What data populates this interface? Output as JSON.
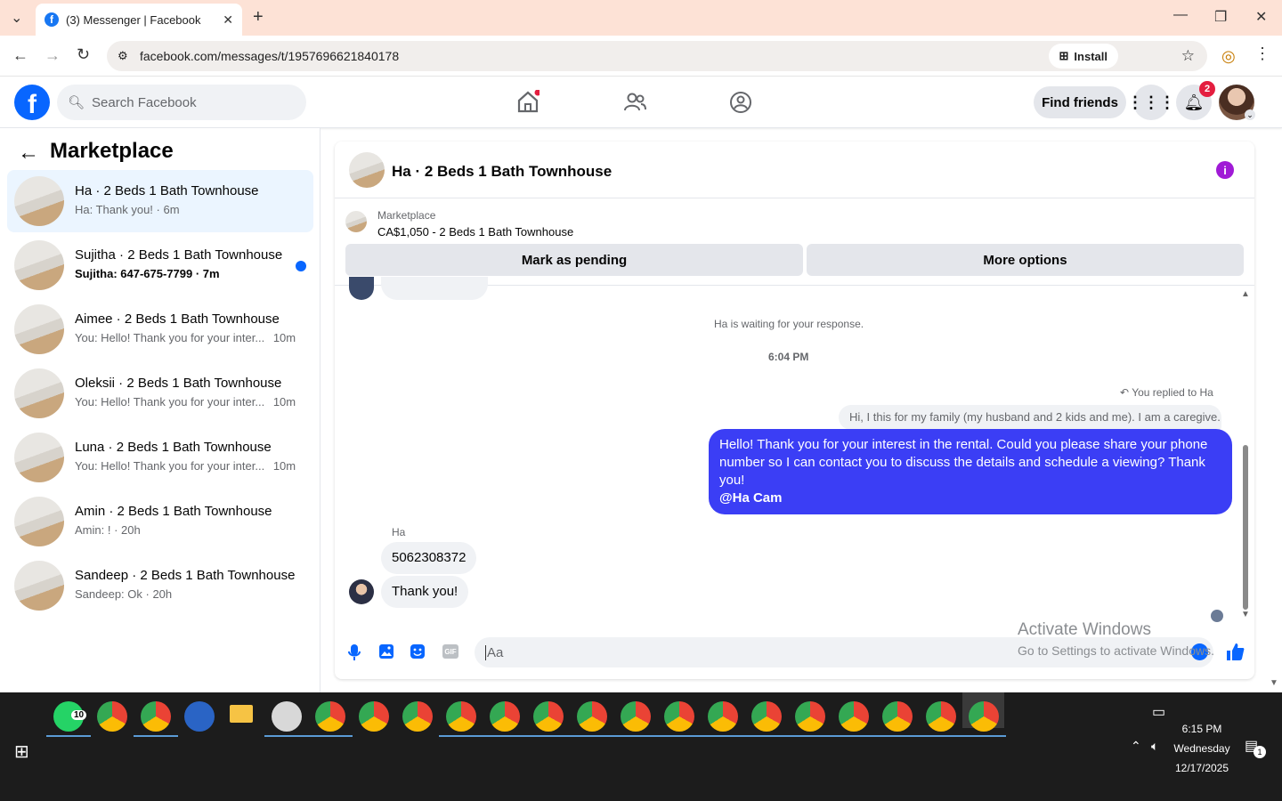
{
  "browser": {
    "tab_title": "(3) Messenger | Facebook",
    "tab_favicon": "f",
    "new_tab": "+",
    "url": "facebook.com/messages/t/1957696621840178",
    "install_label": "Install"
  },
  "fb": {
    "logo": "f",
    "search_placeholder": "Search Facebook",
    "find_friends": "Find friends",
    "notif_count": "2"
  },
  "sidebar": {
    "title": "Marketplace",
    "conversations": [
      {
        "title": "Ha · 2 Beds 1 Bath Townhouse",
        "snippet": "Ha: Thank you! · 6m",
        "selected": true
      },
      {
        "title": "Sujitha · 2 Beds 1 Bath Townhouse",
        "snippet": "Sujitha: 647-675-7799 · 7m",
        "unread": true
      },
      {
        "title": "Aimee · 2 Beds 1 Bath Townhouse",
        "snippet": "You: Hello! Thank you for your inter...",
        "time": "10m"
      },
      {
        "title": "Oleksii · 2 Beds 1 Bath Townhouse",
        "snippet": "You: Hello! Thank you for your inter...",
        "time": "10m"
      },
      {
        "title": "Luna · 2 Beds 1 Bath Townhouse",
        "snippet": "You: Hello! Thank you for your inter...",
        "time": "10m"
      },
      {
        "title": "Amin · 2 Beds 1 Bath Townhouse",
        "snippet": "Amin: ! · 20h"
      },
      {
        "title": "Sandeep · 2 Beds 1 Bath Townhouse",
        "snippet": "Sandeep: Ok · 20h"
      }
    ]
  },
  "chat": {
    "title": "Ha · 2 Beds 1 Bath Townhouse",
    "marketplace_label": "Marketplace",
    "listing": "CA$1,050 - 2 Beds 1 Bath Townhouse",
    "mark_pending": "Mark as pending",
    "more_options": "More options",
    "waiting_notice": "Ha is waiting for your response.",
    "timestamp": "6:04 PM",
    "replied_label": "You replied to Ha",
    "reply_quote": "Hi, I this for my family (my husband and 2 kids and me). I am a caregive...",
    "outgoing_message": "Hello! Thank you for your interest in the rental. Could you please share your phone number so I can contact you to discuss the details and schedule a viewing? Thank you!",
    "outgoing_mention": "@Ha Cam",
    "sender_name": "Ha",
    "incoming_messages": [
      "5062308372",
      "Thank you!"
    ],
    "composer_placeholder": "Aa",
    "gif_label": "GIF"
  },
  "watermark": {
    "line1": "Activate Windows",
    "line2": "Go to Settings to activate Windows."
  },
  "taskbar": {
    "whatsapp_badge": "10",
    "time": "6:15 PM",
    "day": "Wednesday",
    "date": "12/17/2025",
    "notif_badge": "1"
  },
  "colors": {
    "fb_blue": "#0866ff",
    "outgoing_bubble": "#3b3ef5",
    "notif_red": "#e41e3f",
    "tab_strip": "#fde2d6"
  }
}
